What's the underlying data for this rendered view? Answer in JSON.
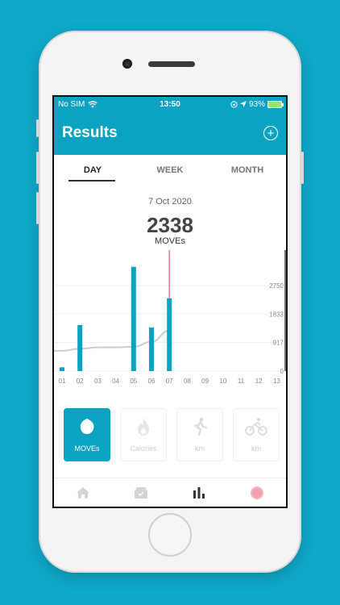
{
  "status_bar": {
    "carrier": "No SIM",
    "time": "13:50",
    "battery": "93%"
  },
  "header": {
    "title": "Results"
  },
  "tabs": [
    {
      "label": "DAY",
      "active": true
    },
    {
      "label": "WEEK",
      "active": false
    },
    {
      "label": "MONTH",
      "active": false
    }
  ],
  "summary": {
    "date": "7 Oct 2020",
    "value": "2338",
    "unit": "MOVEs"
  },
  "chart_data": {
    "type": "bar",
    "categories": [
      "01",
      "02",
      "03",
      "04",
      "05",
      "06",
      "07",
      "08",
      "09",
      "10",
      "11",
      "12",
      "13"
    ],
    "values": [
      120,
      1480,
      0,
      0,
      3350,
      1400,
      2338,
      0,
      0,
      0,
      0,
      0,
      0
    ],
    "line": [
      650,
      720,
      760,
      760,
      780,
      940,
      1300,
      null,
      null,
      null,
      null,
      null,
      null
    ],
    "y_ticks": [
      "0",
      "917",
      "1833",
      "2750"
    ],
    "ylim": [
      0,
      3500
    ],
    "selected_category": "07",
    "bar_color": "#0aa3c2",
    "line_color": "#cccccc",
    "marker_color": "#e45b7a"
  },
  "metric_cards": [
    {
      "label": "MOVEs",
      "icon": "moves-drop-icon",
      "active": true
    },
    {
      "label": "Calories",
      "icon": "calories-flame-icon",
      "active": false
    },
    {
      "label": "km",
      "icon": "walking-icon",
      "active": false
    },
    {
      "label": "km",
      "icon": "cycling-icon",
      "active": false
    }
  ],
  "bottom_nav": [
    {
      "icon": "home-icon"
    },
    {
      "icon": "inbox-icon"
    },
    {
      "icon": "results-chart-icon"
    },
    {
      "icon": "record-icon"
    }
  ],
  "colors": {
    "accent": "#0aa3c2",
    "background": "#0fa8c8"
  }
}
